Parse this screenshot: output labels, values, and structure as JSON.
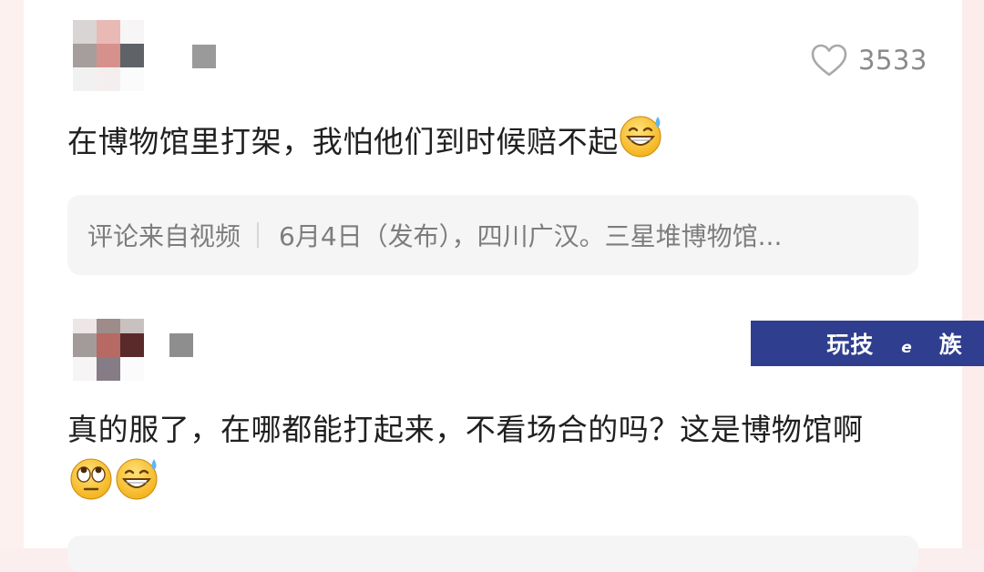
{
  "comments": [
    {
      "like_count": "3533",
      "text": "在博物馆里打架，我怕他们到时候赔不起",
      "emojis": [
        "grinning-sweat-emoji"
      ],
      "source": {
        "label": "评论来自视频",
        "video": "6月4日（发布），四川广汉。三星堆博物馆..."
      }
    },
    {
      "text": "真的服了，在哪都能打起来，不看场合的吗？这是博物馆啊",
      "emojis": [
        "rolling-eyes-emoji",
        "grinning-sweat-emoji"
      ]
    }
  ],
  "watermark": {
    "text_start": "玩技",
    "text_small": "e",
    "text_end": "族"
  },
  "colors": {
    "background": "#fbeeee",
    "card": "#ffffff",
    "source_bar": "#f5f5f5",
    "watermark_bg": "#2f3e8f",
    "muted_text": "#7d7d7d"
  }
}
